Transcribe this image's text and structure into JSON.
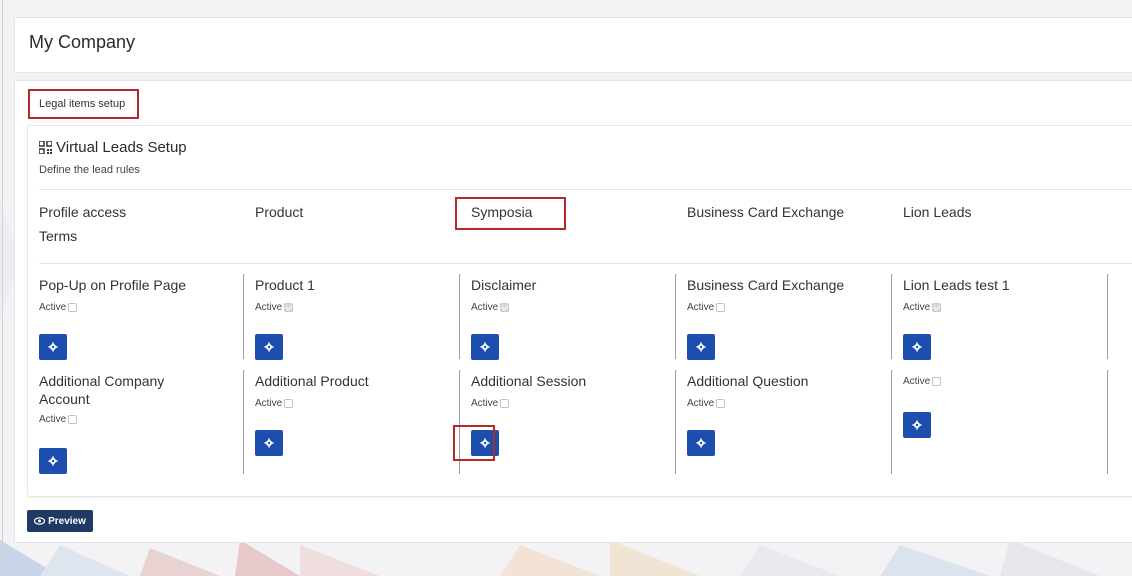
{
  "page": {
    "title": "My Company"
  },
  "tabs": {
    "legal_items": "Legal items setup"
  },
  "setup": {
    "title": "Virtual Leads Setup",
    "subtitle": "Define the lead rules",
    "icon": "qr-code-icon"
  },
  "columns": [
    {
      "label": "Profile access",
      "sub": "Terms"
    },
    {
      "label": "Product"
    },
    {
      "label": "Symposia"
    },
    {
      "label": "Business Card Exchange"
    },
    {
      "label": "Lion Leads"
    }
  ],
  "items": {
    "row1": [
      {
        "name": "Pop-Up on Profile Page",
        "active_label": "Active",
        "checked": false
      },
      {
        "name": "Product 1",
        "active_label": "Active",
        "checked": true
      },
      {
        "name": "Disclaimer",
        "active_label": "Active",
        "checked": true
      },
      {
        "name": "Business Card Exchange",
        "active_label": "Active",
        "checked": false
      },
      {
        "name": "Lion Leads test 1",
        "active_label": "Active",
        "checked": true
      }
    ],
    "row2": [
      {
        "name": "Additional Company Account",
        "active_label": "Active",
        "checked": false
      },
      {
        "name": "Additional Product",
        "active_label": "Active",
        "checked": false
      },
      {
        "name": "Additional Session",
        "active_label": "Active",
        "checked": false
      },
      {
        "name": "Additional Question",
        "active_label": "Active",
        "checked": false
      },
      {
        "name": "",
        "active_label": "Active",
        "checked": false
      }
    ]
  },
  "buttons": {
    "preview": "Preview",
    "settings_icon": "gear-icon",
    "preview_icon": "eye-icon"
  },
  "colors": {
    "primary": "#1e4fae",
    "preview_bg": "#1f3864",
    "highlight": "#b22a2a"
  }
}
